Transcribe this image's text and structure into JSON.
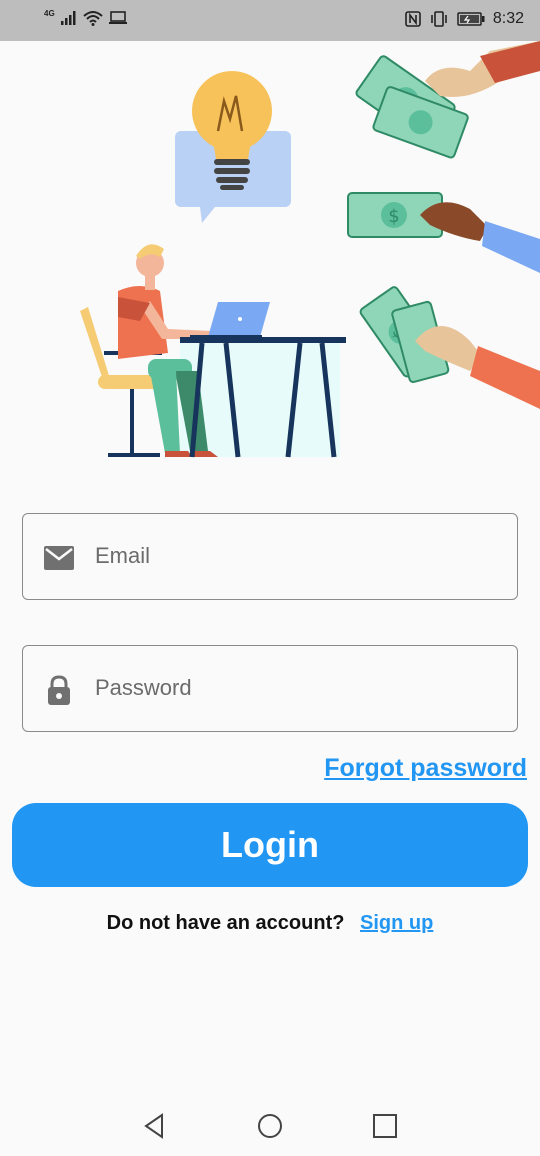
{
  "status_bar": {
    "network": "4G",
    "time": "8:32",
    "icons": [
      "signal-icon",
      "wifi-icon",
      "screen-cast-icon",
      "nfc-icon",
      "vibrate-icon",
      "battery-icon"
    ]
  },
  "illustration": {
    "name": "person-working-laptop-money-hands",
    "colors": {
      "bulb": "#f7c25a",
      "bubble": "#b9d1f5",
      "shirt": "#ee7250",
      "laptop": "#7aa8f3",
      "desk": "#17345c",
      "money": "#8fd5b8",
      "chair": "#f5cc74"
    }
  },
  "form": {
    "email": {
      "placeholder": "Email",
      "value": "",
      "icon": "mail-icon"
    },
    "password": {
      "placeholder": "Password",
      "value": "",
      "icon": "lock-icon"
    },
    "forgot_label": "Forgot password",
    "login_label": "Login",
    "signup_prompt": "Do not have an account?",
    "signup_label": "Sign up"
  },
  "nav": {
    "icons": [
      "back-icon",
      "home-icon",
      "recents-icon"
    ]
  },
  "colors": {
    "accent": "#2196f3",
    "field_border": "#8a8a8a",
    "background": "#fafafa"
  }
}
